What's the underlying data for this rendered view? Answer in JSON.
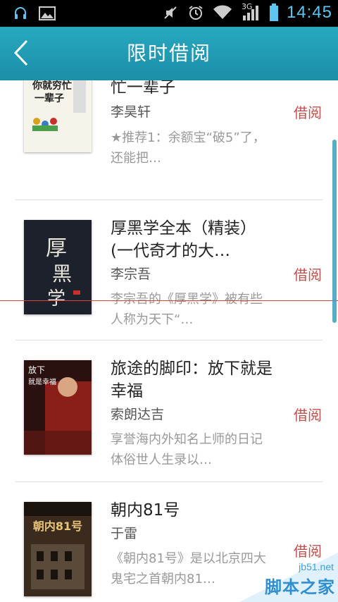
{
  "status_bar": {
    "time": "14:45",
    "network": "3G",
    "icons": [
      "headset-icon",
      "image-icon",
      "mute-icon",
      "alarm-icon",
      "wifi-icon",
      "signal-icon",
      "battery-icon"
    ]
  },
  "header": {
    "title": "限时借阅",
    "back_icon": "chevron-left-icon"
  },
  "books": [
    {
      "title": "不懂投资理财，你就穷忙一辈子",
      "author": "李昊轩",
      "action": "借阅",
      "desc": "★推荐1：余额宝“破5”了，还能把…",
      "cover": {
        "text": "不懂投资理财，你就穷忙一辈子",
        "bg": "#f4f1e8",
        "accent": "#d8a21a"
      }
    },
    {
      "title": "厚黑学全本（精装）(一代奇才的大…",
      "author": "李宗吾",
      "action": "借阅",
      "desc": "李宗吾的《厚黑学》被有些人称为天下“…",
      "cover": {
        "text": "厚黑学",
        "bg": "#1a1f2a",
        "accent": "#e8e4da"
      }
    },
    {
      "title": "旅途的脚印：放下就是幸福",
      "author": "索朗达吉",
      "action": "借阅",
      "desc": "享誉海内外知名上师的日记体俗世人生录以…",
      "cover": {
        "text": "放下就是幸福",
        "bg": "#2a0f0d",
        "accent": "#c9302c"
      }
    },
    {
      "title": "朝内81号",
      "author": "于雷",
      "action": "借阅",
      "desc": "《朝内81号》是以北京四大鬼宅之首朝内81…",
      "cover": {
        "text": "朝内81号",
        "bg": "#3b2a1e",
        "accent": "#d9b36a"
      }
    }
  ],
  "watermark": {
    "url": "jb51.net",
    "name": "脚本之家"
  }
}
